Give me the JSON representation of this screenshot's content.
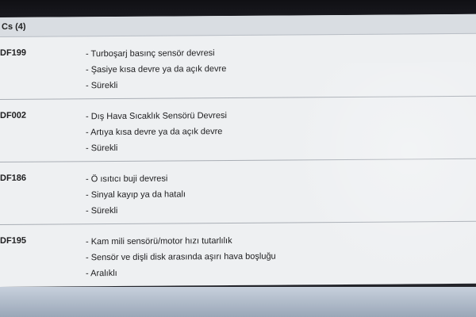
{
  "header": {
    "title": "Cs (4)"
  },
  "faults": [
    {
      "code": "DF199",
      "lines": [
        "- Turboşarj basınç sensör devresi",
        "- Şasiye kısa devre ya da açık devre",
        "- Sürekli"
      ]
    },
    {
      "code": "DF002",
      "lines": [
        "- Dış Hava Sıcaklık Sensörü Devresi",
        "- Artıya kısa devre ya da açık devre",
        "- Sürekli"
      ]
    },
    {
      "code": "DF186",
      "lines": [
        "- Ö ısıtıcı buji devresi",
        "- Sinyal kayıp ya da hatalı",
        "- Sürekli"
      ]
    },
    {
      "code": "DF195",
      "lines": [
        "- Kam mili sensörü/motor hızı tutarlılık",
        "- Sensör ve dişli disk arasında aşırı hava boşluğu",
        "- Aralıklı"
      ]
    }
  ]
}
